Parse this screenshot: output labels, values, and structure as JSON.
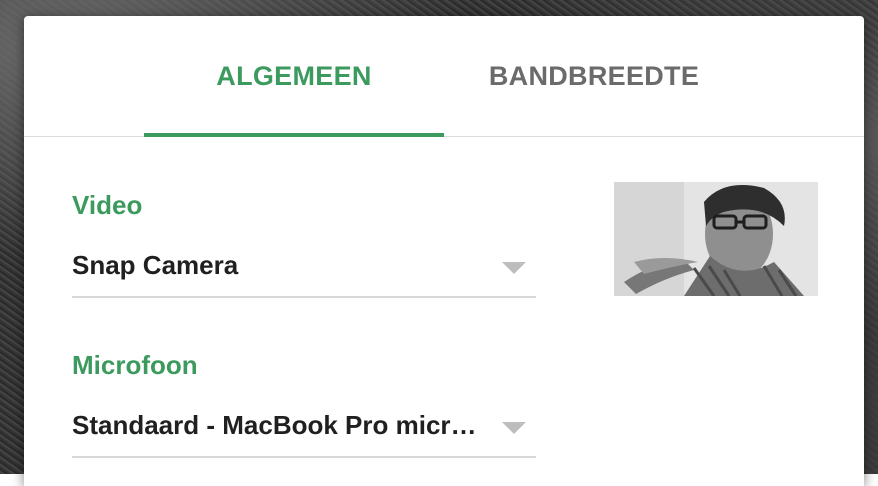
{
  "tabs": [
    {
      "label": "ALGEMEEN",
      "active": true
    },
    {
      "label": "BANDBREEDTE",
      "active": false
    }
  ],
  "video": {
    "label": "Video",
    "selected": "Snap Camera"
  },
  "microphone": {
    "label": "Microfoon",
    "selected": "Standaard - MacBook Pro micr…"
  },
  "colors": {
    "accent": "#3d9a5f",
    "inactive_tab": "#6b6b6b",
    "text": "#202020",
    "divider": "#d8d8d8"
  },
  "icons": {
    "dropdown": "triangle-down-icon"
  }
}
